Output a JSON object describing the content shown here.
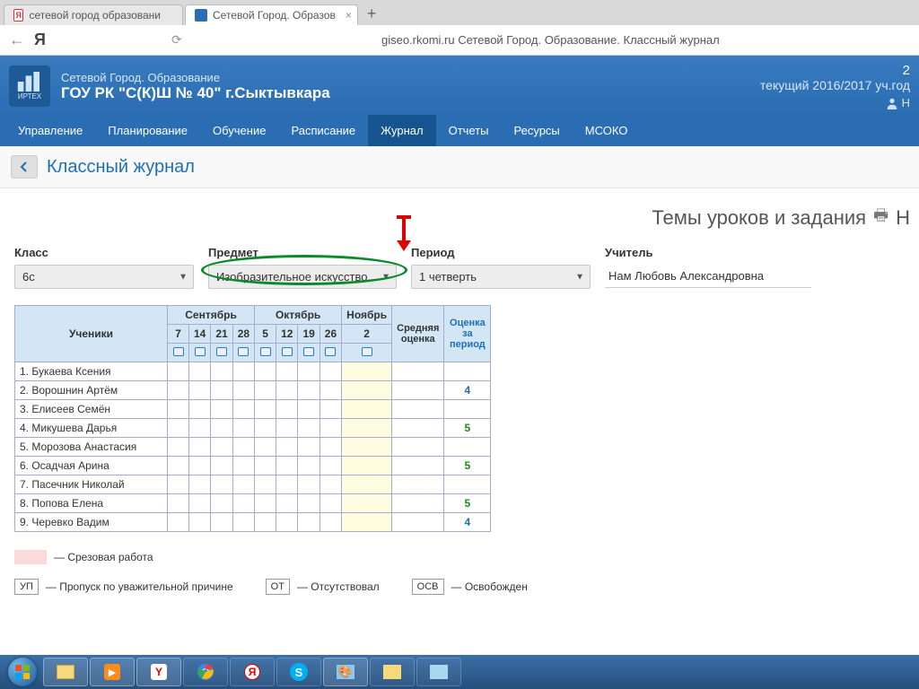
{
  "browser": {
    "tabs": [
      {
        "label": "сетевой город образовани"
      },
      {
        "label": "Сетевой Город. Образов"
      }
    ],
    "address": "giseo.rkomi.ru Сетевой Город. Образование. Классный журнал",
    "ya": "Я"
  },
  "header": {
    "sub": "Сетевой Город. Образование",
    "main": "ГОУ РК \"С(К)Ш № 40\" г.Сыктывкара",
    "logo_label": "ИРТЕХ",
    "year_label": "текущий 2016/2017 уч.год",
    "notif": "2",
    "user_short": "Н"
  },
  "nav": {
    "items": [
      "Управление",
      "Планирование",
      "Обучение",
      "Расписание",
      "Журнал",
      "Отчеты",
      "Ресурсы",
      "МСОКО"
    ],
    "active_index": 4
  },
  "page_title": "Классный журнал",
  "section_title": "Темы уроков и задания",
  "section_title_cut": "Н",
  "filters": {
    "class_label": "Класс",
    "class_value": "6с",
    "subject_label": "Предмет",
    "subject_value": "Изобразительное искусство",
    "period_label": "Период",
    "period_value": "1 четверть",
    "teacher_label": "Учитель",
    "teacher_value": "Нам Любовь Александровна"
  },
  "table": {
    "students_header": "Ученики",
    "avg_header": "Средняя оценка",
    "period_grade_header": "Оценка за период",
    "months": [
      {
        "name": "Сентябрь",
        "dates": [
          "7",
          "14",
          "21",
          "28"
        ]
      },
      {
        "name": "Октябрь",
        "dates": [
          "5",
          "12",
          "19",
          "26"
        ]
      },
      {
        "name": "Ноябрь",
        "dates": [
          "2"
        ]
      }
    ],
    "students": [
      {
        "n": "1.",
        "name": "Букаева Ксения",
        "period_grade": ""
      },
      {
        "n": "2.",
        "name": "Ворошнин Артём",
        "period_grade": "4"
      },
      {
        "n": "3.",
        "name": "Елисеев Семён",
        "period_grade": ""
      },
      {
        "n": "4.",
        "name": "Микушева Дарья",
        "period_grade": "5"
      },
      {
        "n": "5.",
        "name": "Морозова Анастасия",
        "period_grade": ""
      },
      {
        "n": "6.",
        "name": "Осадчая Арина",
        "period_grade": "5"
      },
      {
        "n": "7.",
        "name": "Пасечник Николай",
        "period_grade": ""
      },
      {
        "n": "8.",
        "name": "Попова Елена",
        "period_grade": "5"
      },
      {
        "n": "9.",
        "name": "Черевко Вадим",
        "period_grade": "4"
      }
    ]
  },
  "legend": {
    "cut_work": "— Срезовая работа",
    "up_code": "УП",
    "up_text": "— Пропуск по уважительной причине",
    "ot_code": "ОТ",
    "ot_text": "— Отсутствовал",
    "osv_code": "ОСВ",
    "osv_text": "— Освобожден"
  }
}
